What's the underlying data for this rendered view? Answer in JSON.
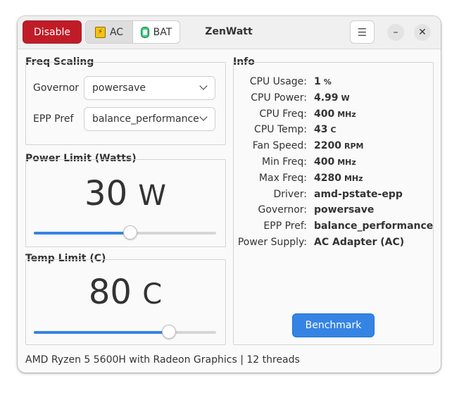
{
  "header": {
    "disable_label": "Disable",
    "ac_label": "AC",
    "bat_label": "BAT",
    "title": "ZenWatt",
    "menu_glyph": "☰",
    "minimize_glyph": "–",
    "close_glyph": "✕"
  },
  "freq_scaling": {
    "title": "Freq Scaling",
    "governor_label": "Governor",
    "governor_value": "powersave",
    "epp_label": "EPP Pref",
    "epp_value": "balance_performance"
  },
  "power_limit": {
    "title": "Power Limit (Watts)",
    "value": "30",
    "unit": "W",
    "slider_fraction": 0.53
  },
  "temp_limit": {
    "title": "Temp Limit (C)",
    "value": "80",
    "unit": "C",
    "slider_fraction": 0.74
  },
  "info": {
    "title": "Info",
    "rows": [
      {
        "key": "CPU Usage:",
        "value": "1",
        "unit": "%"
      },
      {
        "key": "CPU Power:",
        "value": "4.99",
        "unit": "W"
      },
      {
        "key": "CPU Freq:",
        "value": "400",
        "unit": "MHz"
      },
      {
        "key": "CPU Temp:",
        "value": "43",
        "unit": "C"
      },
      {
        "key": "Fan Speed:",
        "value": "2200",
        "unit": "RPM"
      },
      {
        "key": "Min Freq:",
        "value": "400",
        "unit": "MHz"
      },
      {
        "key": "Max Freq:",
        "value": "4280",
        "unit": "MHz"
      },
      {
        "key": "Driver:",
        "value": "amd-pstate-epp",
        "unit": ""
      },
      {
        "key": "Governor:",
        "value": "powersave",
        "unit": ""
      },
      {
        "key": "EPP Pref:",
        "value": "balance_performance",
        "unit": ""
      },
      {
        "key": "Power Supply:",
        "value": "AC Adapter (AC)",
        "unit": ""
      }
    ],
    "benchmark_label": "Benchmark"
  },
  "status": {
    "text": "AMD Ryzen 5 5600H with Radeon Graphics | 12 threads"
  },
  "colors": {
    "destructive": "#c01c28",
    "accent": "#3584e4"
  }
}
